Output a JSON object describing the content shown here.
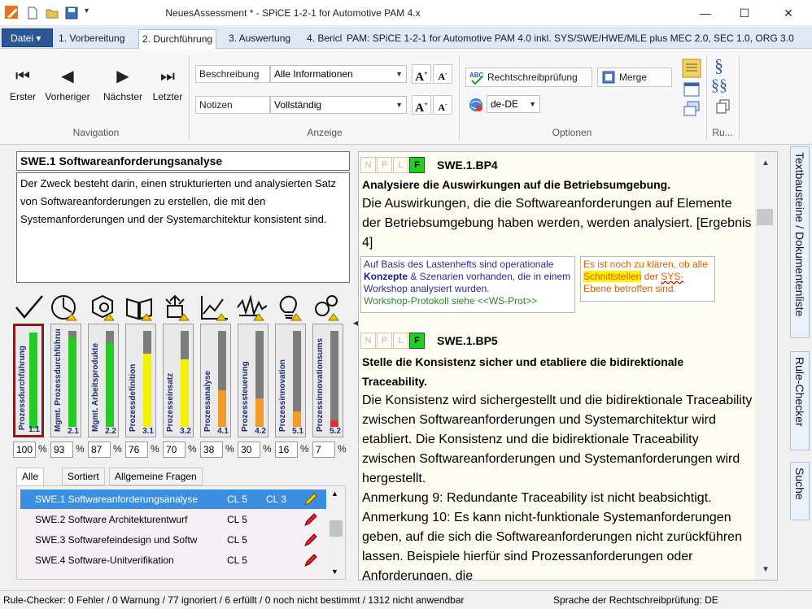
{
  "window": {
    "title": "NeuesAssessment * - SPiCE 1-2-1 for Automotive PAM 4.x",
    "controls": {
      "minimize": "—",
      "maximize": "☐",
      "close": "✕"
    }
  },
  "menu": {
    "datei": "Datei ▾",
    "tabs": [
      "1. Vorbereitung",
      "2. Durchführung",
      "3. Auswertung",
      "4. Bericl"
    ],
    "model_info": "PAM: SPiCE 1-2-1 for Automotive PAM 4.0 inkl. SYS/SWE/HWE/MLE plus MEC 2.0, SEC 1.0, ORG 3.0"
  },
  "ribbon": {
    "navigation": {
      "label": "Navigation",
      "buttons": [
        {
          "label": "Erster",
          "icon": "first-icon"
        },
        {
          "label": "Vorheriger",
          "icon": "previous-icon"
        },
        {
          "label": "Nächster",
          "icon": "next-icon"
        },
        {
          "label": "Letzter",
          "icon": "last-icon"
        }
      ]
    },
    "anzeige": {
      "label": "Anzeige",
      "beschreibung_label": "Beschreibung",
      "beschreibung_value": "Alle Informationen",
      "notizen_label": "Notizen",
      "notizen_value": "Vollständig"
    },
    "optionen": {
      "label": "Optionen",
      "spellcheck": "Rechtschreibprüfung",
      "merge": "Merge",
      "language": "de-DE"
    },
    "ru_label": "Ru..."
  },
  "process": {
    "title": "SWE.1  Softwareanforderungsanalyse",
    "description": "Der Zweck besteht darin, einen strukturierten und analysierten Satz von Softwareanforderungen zu erstellen, die mit den Systemanforderungen und der Systemarchitektur konsistent sind."
  },
  "attributes": [
    {
      "label": "Prozessdurchführung",
      "id": "1.1",
      "value": 100,
      "color": "#22cc22"
    },
    {
      "label": "Mgmt. Prozessdurchführung",
      "id": "2.1",
      "value": 93,
      "color": "#22cc22"
    },
    {
      "label": "Mgmt. Arbeitsprodukte",
      "id": "2.2",
      "value": 87,
      "color": "#22cc22"
    },
    {
      "label": "Prozessdefinition",
      "id": "3.1",
      "value": 76,
      "color": "#f2f200"
    },
    {
      "label": "Prozesseinsatz",
      "id": "3.2",
      "value": 70,
      "color": "#f2f200"
    },
    {
      "label": "Prozessanalyse",
      "id": "4.1",
      "value": 38,
      "color": "#f39a2a"
    },
    {
      "label": "Prozesssteuerung",
      "id": "4.2",
      "value": 30,
      "color": "#f39a2a"
    },
    {
      "label": "Prozessinnovation",
      "id": "5.1",
      "value": 16,
      "color": "#f39a2a"
    },
    {
      "label": "Prozessinnovationsums",
      "id": "5.2",
      "value": 7,
      "color": "#e03030"
    }
  ],
  "attribute_icons": [
    "checkmark-icon",
    "clock-chart-icon",
    "cube-magnifier-icon",
    "book-icon",
    "deploy-icon",
    "trend-chart-icon",
    "waveform-icon",
    "lightbulb-icon",
    "gears-icon"
  ],
  "percent_sign": "%",
  "list_tabs": [
    "Alle",
    "Sortiert",
    "Allgemeine Fragen"
  ],
  "process_list": [
    {
      "name": "SWE.1 Softwareanforderungsanalyse",
      "cl": "CL 5",
      "cl2": "CL 3"
    },
    {
      "name": "SWE.2 Software Architekturentwurf",
      "cl": "CL 5",
      "cl2": ""
    },
    {
      "name": "SWE.3 Softwarefeindesign und Softw",
      "cl": "CL 5",
      "cl2": ""
    },
    {
      "name": "SWE.4 Software-Unitverifikation",
      "cl": "CL 5",
      "cl2": ""
    }
  ],
  "rating_letters": [
    "N",
    "P",
    "L",
    "F"
  ],
  "base_practices": [
    {
      "id": "SWE.1.BP4",
      "heading": "Analysiere die Auswirkungen auf die Betriebsumgebung.",
      "text": "Die Auswirkungen, die die Softwareanforderungen auf Elemente der Betriebsumgebung haben werden, werden analysiert. [Ergebnis 4]",
      "note_left_1": "Auf Basis des Lastenhefts sind operationale",
      "note_left_2": "Konzepte",
      "note_left_3": " & Szenarien vorhanden, die in einem Workshop analysiert wurden.",
      "note_left_4": "Workshop-Protokoll siehe <<WS-Prot>>",
      "note_right_1": "Es ist noch zu klären, ob alle",
      "note_right_2": "Schnittstellen",
      "note_right_3": " der ",
      "note_right_4": "SYS-",
      "note_right_5": "Ebene betroffen sind."
    },
    {
      "id": "SWE.1.BP5",
      "heading": "Stelle die Konsistenz sicher und etabliere die bidirektionale Traceability.",
      "text": "Die Konsistenz wird sichergestellt und die bidirektionale Traceability zwischen Softwareanforderungen und Systemarchitektur wird etabliert. Die Konsistenz und die bidirektionale Traceability zwischen Softwareanforderungen und Systemanforderungen wird hergestellt.",
      "note9": "Anmerkung 9: Redundante Traceability ist nicht beabsichtigt.",
      "note10": "Anmerkung 10: Es kann nicht-funktionale Systemanforderungen geben, auf die sich die Softwareanforderungen nicht zurückführen lassen. Beispiele hierfür sind Prozessanforderungen oder Anforderungen, die"
    }
  ],
  "side_tabs": [
    "Textbausteine / Dokumentenliste",
    "Rule-Checker",
    "Suche"
  ],
  "status": {
    "rule_checker": "Rule-Checker: 0 Fehler / 0 Warnung / 77 ignoriert / 6 erfüllt / 0 noch nicht bestimmt / 1312 nicht anwendbar",
    "language": "Sprache der Rechtschreibprüfung:  DE"
  }
}
